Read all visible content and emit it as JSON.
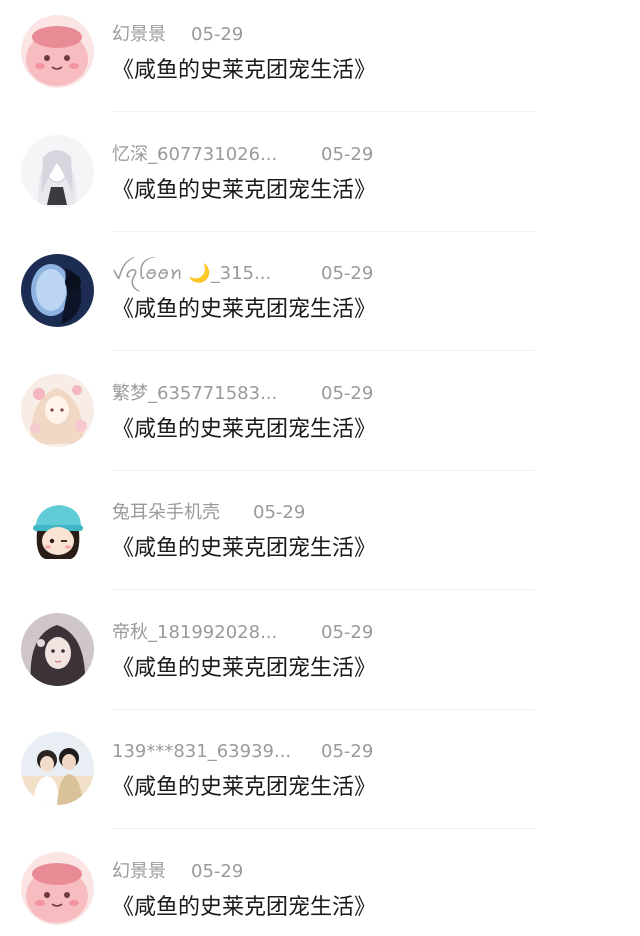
{
  "comments": [
    {
      "user": "幻景景",
      "date": "05-29",
      "book": "《咸鱼的史莱克团宠生活》",
      "avatar": "pink-blob-avatar"
    },
    {
      "user": "忆深_607731026...",
      "date": "05-29",
      "book": "《咸鱼的史莱克团宠生活》",
      "avatar": "sketch-girl-avatar"
    },
    {
      "user": "ꪜꪖꪶꪮꪮꪀ 🌙_315...",
      "date": "05-29",
      "book": "《咸鱼的史莱克团宠生活》",
      "avatar": "airplane-window-avatar"
    },
    {
      "user": "繁梦_635771583...",
      "date": "05-29",
      "book": "《咸鱼的史莱克团宠生活》",
      "avatar": "anime-girl-flowers-avatar"
    },
    {
      "user": "兔耳朵手机壳",
      "date": "05-29",
      "book": "《咸鱼的史莱克团宠生活》",
      "avatar": "cartoon-hat-girl-avatar"
    },
    {
      "user": "帝秋_181992028...",
      "date": "05-29",
      "book": "《咸鱼的史莱克团宠生活》",
      "avatar": "dark-hair-girl-avatar"
    },
    {
      "user": "139***831_63939...",
      "date": "05-29",
      "book": "《咸鱼的史莱克团宠生活》",
      "avatar": "couple-photo-avatar"
    },
    {
      "user": "幻景景",
      "date": "05-29",
      "book": "《咸鱼的史莱克团宠生活》",
      "avatar": "pink-blob-avatar"
    }
  ]
}
